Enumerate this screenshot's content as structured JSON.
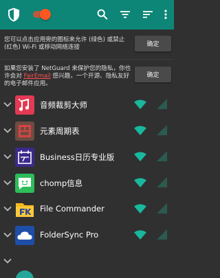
{
  "colors": {
    "appbar": "#0e8677",
    "background": "#303030",
    "accent": "#ff5722",
    "wifi_allowed": "#19b89e",
    "cell_blocked": "#2b5a4f",
    "link": "#ff5252"
  },
  "toolbar": {
    "toggle_state": "on",
    "icons": [
      "shield-icon",
      "search-icon",
      "filter-icon",
      "sort-icon",
      "more-vert-icon"
    ]
  },
  "banners": [
    {
      "text": "您可以点击应用旁的图标来允许 (绿色) 或禁止 (红色) Wi-Fi 或移动网络连接",
      "button": "确定"
    },
    {
      "text_before": "如果您安装了 NetGuard 来保护您的隐私，你也许会对 ",
      "link": "FairEmail",
      "text_after": " 感兴趣，一个开源、隐私友好的电子邮件应用。",
      "button": "确定"
    }
  ],
  "apps": [
    {
      "name": "音频裁剪大师",
      "icon": "audio-cutter-icon",
      "wifi": "allowed",
      "mobile": "allowed"
    },
    {
      "name": "元素周期表",
      "icon": "periodic-table-icon",
      "wifi": "allowed",
      "mobile": "allowed"
    },
    {
      "name": "Business日历专业版",
      "icon": "business-calendar-icon",
      "wifi": "allowed",
      "mobile": "allowed"
    },
    {
      "name": "chomp信息",
      "icon": "chomp-sms-icon",
      "wifi": "allowed",
      "mobile": "allowed"
    },
    {
      "name": "File Commander",
      "icon": "file-commander-icon",
      "wifi": "allowed",
      "mobile": "allowed"
    },
    {
      "name": "FolderSync Pro",
      "icon": "foldersync-icon",
      "wifi": "allowed",
      "mobile": "allowed"
    }
  ]
}
